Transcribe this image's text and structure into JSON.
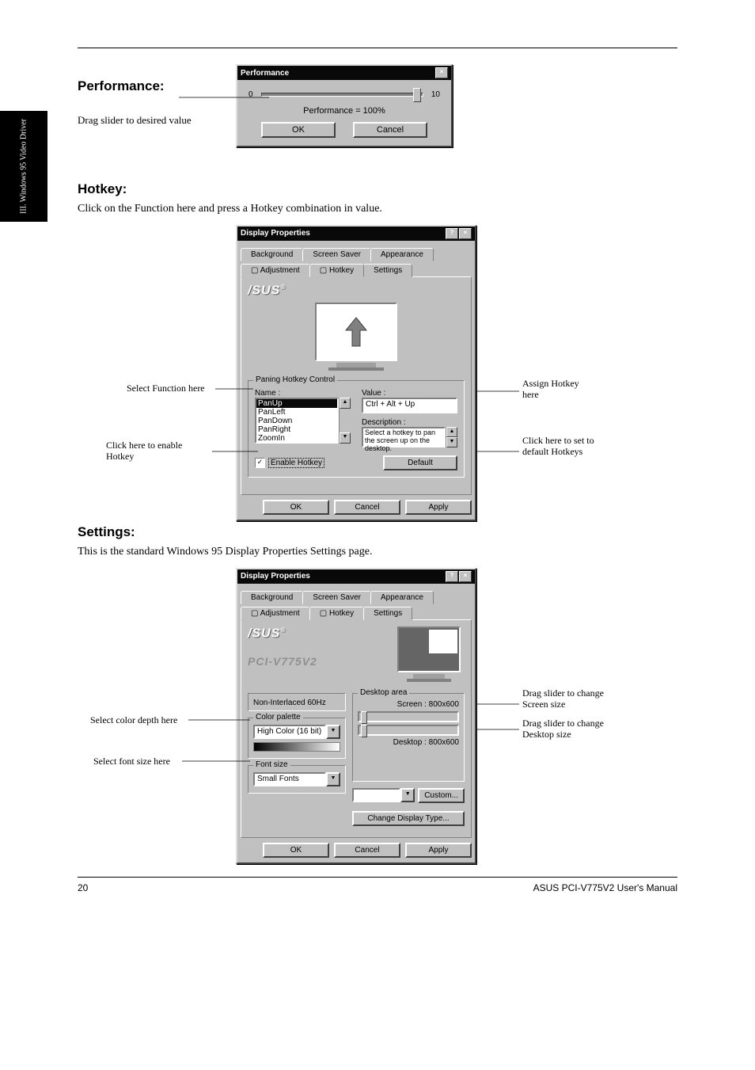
{
  "page": {
    "header_rule": true,
    "side_tab": "III. Windows 95\nVideo Driver",
    "footer_left": "20",
    "footer_right": "ASUS PCI-V775V2 User's Manual"
  },
  "sections": {
    "perf": {
      "title": "Performance:",
      "text": "Drag slider to desired value"
    },
    "hotkey": {
      "title": "Hotkey:",
      "text": "Click on the Function here and press a Hotkey combination in value."
    },
    "settings": {
      "title": "Settings:",
      "text": "This is the standard Windows 95 Display Properties Settings page."
    }
  },
  "perf_dlg": {
    "title": "Performance",
    "min": "0",
    "max": "10",
    "label": "Performance = 100%",
    "ok": "OK",
    "cancel": "Cancel"
  },
  "dp": {
    "title": "Display Properties",
    "tabs": {
      "background": "Background",
      "screensaver": "Screen Saver",
      "appearance": "Appearance",
      "adjustment": "Adjustment",
      "hotkey": "Hotkey",
      "settings": "Settings"
    },
    "ok": "OK",
    "cancel": "Cancel",
    "apply": "Apply"
  },
  "hotkey_dlg": {
    "group": "Paning Hotkey Control",
    "name_label": "Name :",
    "value_label": "Value :",
    "desc_label": "Description :",
    "list": [
      "PanUp",
      "PanLeft",
      "PanDown",
      "PanRight",
      "ZoomIn"
    ],
    "value": "Ctrl + Alt + Up",
    "desc": "Select a hotkey to pan the screen up on the desktop.",
    "enable": "Enable Hotkey",
    "default": "Default"
  },
  "settings_dlg": {
    "brand": "/SUS",
    "product": "PCI-V775V2",
    "refresh": "Non-Interlaced 60Hz",
    "color_label": "Color palette",
    "color_value": "High Color (16 bit)",
    "font_label": "Font size",
    "font_value": "Small Fonts",
    "desktop_label": "Desktop area",
    "screen_info": "Screen : 800x600",
    "desktop_info": "Desktop : 800x600",
    "custom": "Custom...",
    "change": "Change Display Type..."
  },
  "callouts": {
    "perf_slider": "Drag slider to desired value",
    "hk_list": "Select Function here",
    "hk_value": "Assign Hotkey here",
    "hk_enable": "Click here to enable Hotkey",
    "hk_default": "Click here to set to default Hotkeys",
    "set_color": "Select color depth here",
    "set_font": "Select font size here",
    "set_screen": "Drag slider to change Screen size",
    "set_desktop": "Drag slider to change Desktop size"
  }
}
